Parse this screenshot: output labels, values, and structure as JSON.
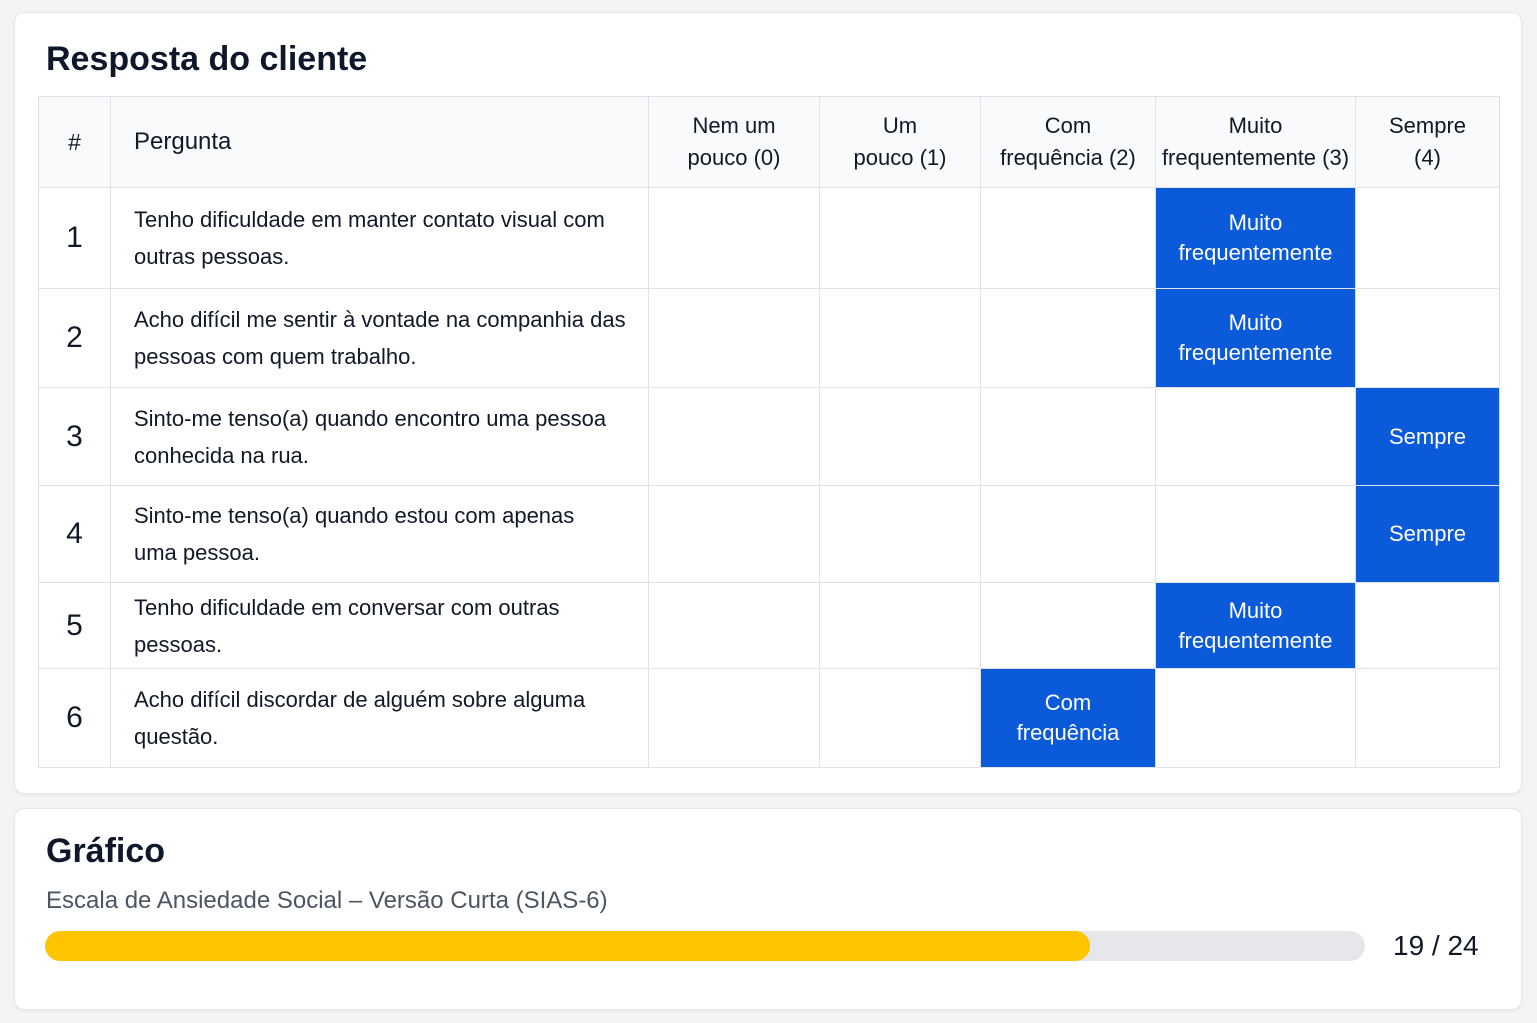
{
  "response": {
    "title": "Resposta do cliente",
    "headers": {
      "num": "#",
      "question": "Pergunta",
      "options": [
        [
          "Nem um",
          "pouco (0)"
        ],
        [
          "Um",
          "pouco (1)"
        ],
        [
          "Com",
          "frequência (2)"
        ],
        [
          "Muito",
          "frequentemente (3)"
        ],
        [
          "Sempre",
          "(4)"
        ]
      ]
    },
    "rows": [
      {
        "num": "1",
        "question": [
          "Tenho dificuldade em manter contato visual com",
          "outras pessoas."
        ],
        "selected": 3,
        "answer": [
          "Muito",
          "frequentemente"
        ]
      },
      {
        "num": "2",
        "question": [
          "Acho difícil me sentir à vontade na companhia das",
          "pessoas com quem trabalho."
        ],
        "selected": 3,
        "answer": [
          "Muito",
          "frequentemente"
        ]
      },
      {
        "num": "3",
        "question": [
          "Sinto-me tenso(a) quando encontro uma pessoa",
          "conhecida na rua."
        ],
        "selected": 4,
        "answer": [
          "Sempre"
        ]
      },
      {
        "num": "4",
        "question": [
          "Sinto-me tenso(a) quando estou com apenas",
          "uma pessoa."
        ],
        "selected": 4,
        "answer": [
          "Sempre"
        ]
      },
      {
        "num": "5",
        "question": [
          "Tenho dificuldade em conversar com outras pessoas."
        ],
        "selected": 3,
        "answer": [
          "Muito",
          "frequentemente"
        ]
      },
      {
        "num": "6",
        "question": [
          "Acho difícil discordar de alguém sobre alguma",
          "questão."
        ],
        "selected": 2,
        "answer": [
          "Com",
          "frequência"
        ]
      }
    ]
  },
  "chart": {
    "title": "Gráfico",
    "subtitle": "Escala de Ansiedade Social – Versão Curta (SIAS-6)",
    "score": 19,
    "max": 24,
    "score_text": "19 / 24",
    "fill_color": "#ffc400",
    "track_color": "#e5e7eb"
  },
  "colors": {
    "selected_bg": "#0a5ad9",
    "selected_text": "#ffffff"
  }
}
